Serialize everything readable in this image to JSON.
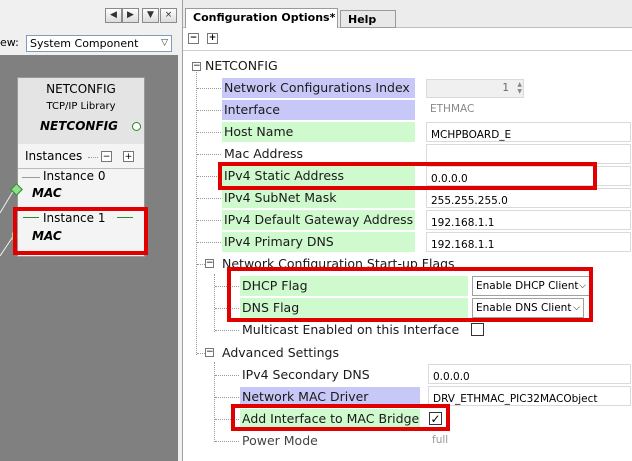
{
  "left": {
    "nav_prev": "◀",
    "nav_next": "▶",
    "nav_menu": "▼",
    "nav_close": "×",
    "view_label": "ew:",
    "view_value": "System Component",
    "node": {
      "title": "NETCONFIG",
      "subtitle": "TCP/IP Library",
      "name": "NETCONFIG",
      "instances_label": "Instances",
      "instance0_label": "Instance 0",
      "instance0_mac": "MAC",
      "instance1_label": "Instance 1",
      "instance1_mac": "MAC"
    }
  },
  "tabs": [
    {
      "label": "Configuration Options*"
    },
    {
      "label": "Help"
    }
  ],
  "toolbar": {
    "collapse": "−",
    "expand": "+"
  },
  "tree": {
    "root": "NETCONFIG",
    "rows": [
      {
        "label": "Network Configurations Index",
        "value": "1"
      },
      {
        "label": "Interface",
        "value": "ETHMAC"
      },
      {
        "label": "Host Name",
        "value": "MCHPBOARD_E"
      },
      {
        "label": "Mac Address",
        "value": ""
      },
      {
        "label": "IPv4 Static Address",
        "value": "0.0.0.0"
      },
      {
        "label": "IPv4 SubNet Mask",
        "value": "255.255.255.0"
      },
      {
        "label": "IPv4 Default Gateway Address",
        "value": "192.168.1.1"
      },
      {
        "label": "IPv4 Primary DNS",
        "value": "192.168.1.1"
      }
    ],
    "flags_group": "Network Configuration Start-up Flags",
    "flags": [
      {
        "label": "DHCP Flag",
        "value": "Enable DHCP Client"
      },
      {
        "label": "DNS Flag",
        "value": "Enable DNS Client"
      },
      {
        "label": "Multicast Enabled on this Interface",
        "checked": false
      }
    ],
    "advanced_group": "Advanced Settings",
    "advanced": [
      {
        "label": "IPv4 Secondary DNS",
        "value": "0.0.0.0"
      },
      {
        "label": "Network MAC Driver",
        "value": "DRV_ETHMAC_PIC32MACObject"
      },
      {
        "label": "Add Interface to MAC Bridge",
        "checked": true,
        "check": "✓"
      },
      {
        "label": "Power Mode",
        "value": "full"
      }
    ]
  },
  "colors": {
    "highlight": "#e00000",
    "purple_row": "#c8c8f8",
    "green_row": "#cfface"
  }
}
